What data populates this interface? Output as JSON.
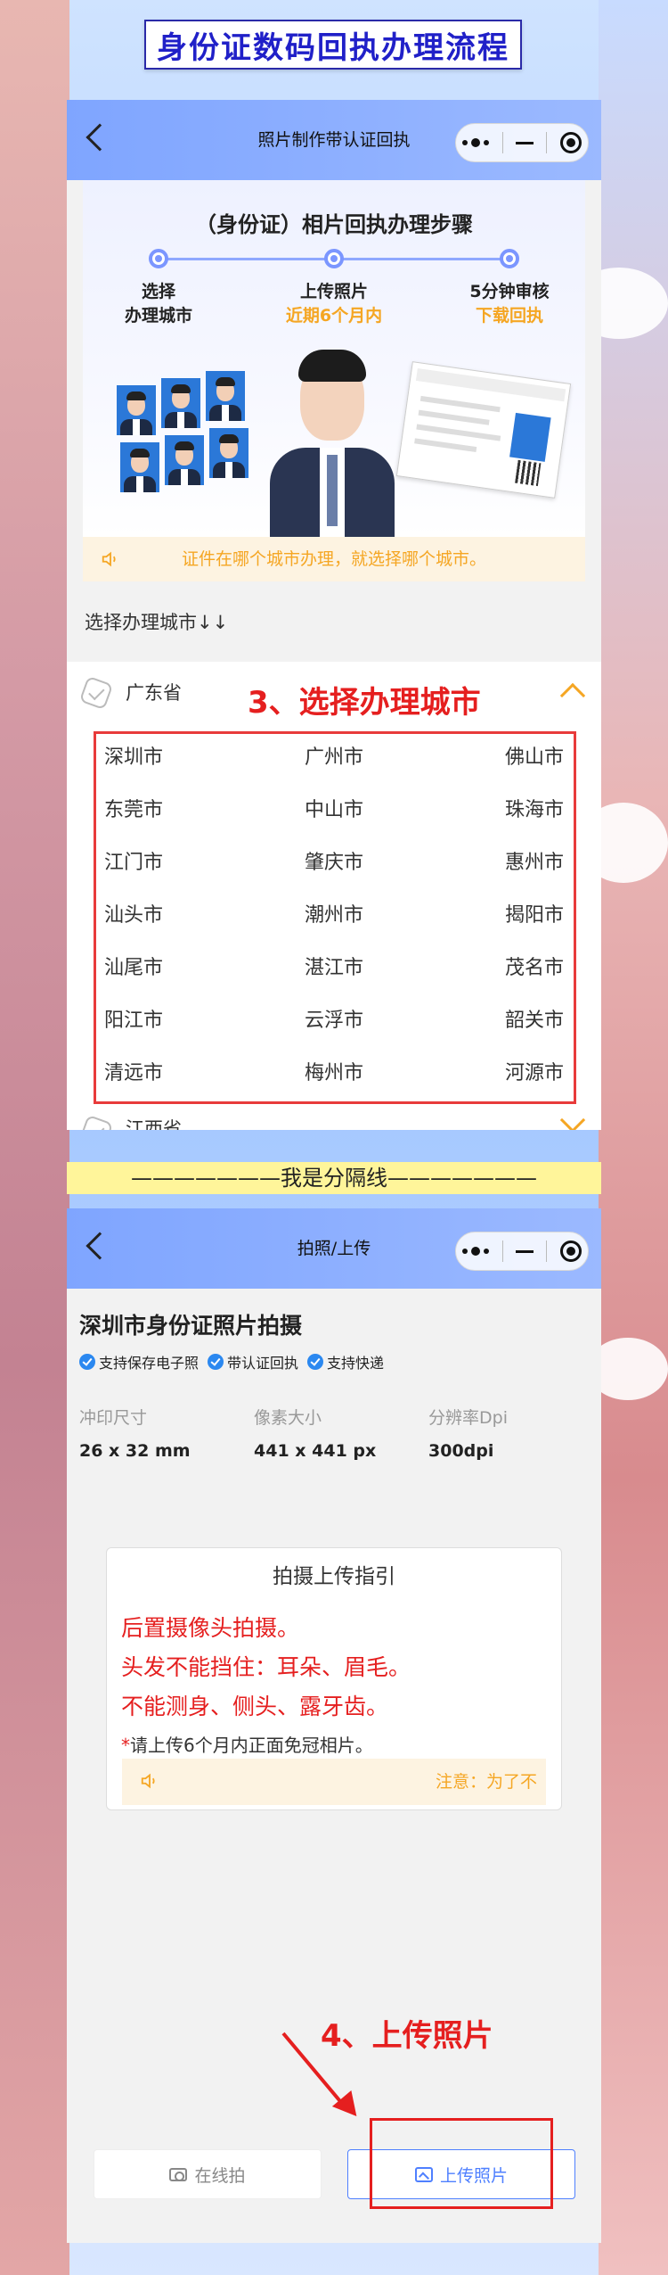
{
  "banner": {
    "title": "身份证数码回执办理流程"
  },
  "panel1": {
    "nav_title": "照片制作带认证回执",
    "steps_heading": "（身份证）相片回执办理步骤",
    "steps": [
      {
        "line1": "选择",
        "line2": "办理城市"
      },
      {
        "line1": "上传照片",
        "line2": "近期6个月内"
      },
      {
        "line1": "5分钟审核",
        "line2": "下载回执"
      }
    ],
    "notice": "证件在哪个城市办理，就选择哪个城市。",
    "select_label": "选择办理城市↓↓",
    "province_open": "广东省",
    "cities": [
      "深圳市",
      "广州市",
      "佛山市",
      "东莞市",
      "中山市",
      "珠海市",
      "江门市",
      "肇庆市",
      "惠州市",
      "汕头市",
      "潮州市",
      "揭阳市",
      "汕尾市",
      "湛江市",
      "茂名市",
      "阳江市",
      "云浮市",
      "韶关市",
      "清远市",
      "梅州市",
      "河源市"
    ],
    "province_next": "江西省",
    "annotation": "3、选择办理城市"
  },
  "divider": "———————我是分隔线———————",
  "panel2": {
    "nav_title": "拍照/上传",
    "title": "深圳市身份证照片拍摄",
    "badges": [
      "支持保存电子照",
      "带认证回执",
      "支持快递"
    ],
    "specs": [
      {
        "key": "冲印尺寸",
        "value": "26 x 32 mm"
      },
      {
        "key": "像素大小",
        "value": "441 x 441 px"
      },
      {
        "key": "分辨率Dpi",
        "value": "300dpi"
      }
    ],
    "guide": {
      "title": "拍摄上传指引",
      "red_lines": [
        "后置摄像头拍摄。",
        "头发不能挡住：耳朵、眉毛。",
        "不能测身、侧头、露牙齿。"
      ],
      "note_star": "*",
      "note": "请上传6个月内正面免冠相片。",
      "notice": "注意：为了不"
    },
    "annotation": "4、上传照片",
    "btn_camera": "在线拍",
    "btn_upload": "上传照片"
  },
  "colors": {
    "accent_orange": "#f5a623",
    "annotation_red": "#e51f1f",
    "nav_blue": "#7fa5ff",
    "link_blue": "#4f80ff"
  },
  "icons": [
    "back-icon",
    "more-dots-icon",
    "minimize-icon",
    "target-icon",
    "speaker-icon",
    "check-badge-icon",
    "chevron-up-icon",
    "chevron-down-icon",
    "camera-icon",
    "image-icon"
  ]
}
